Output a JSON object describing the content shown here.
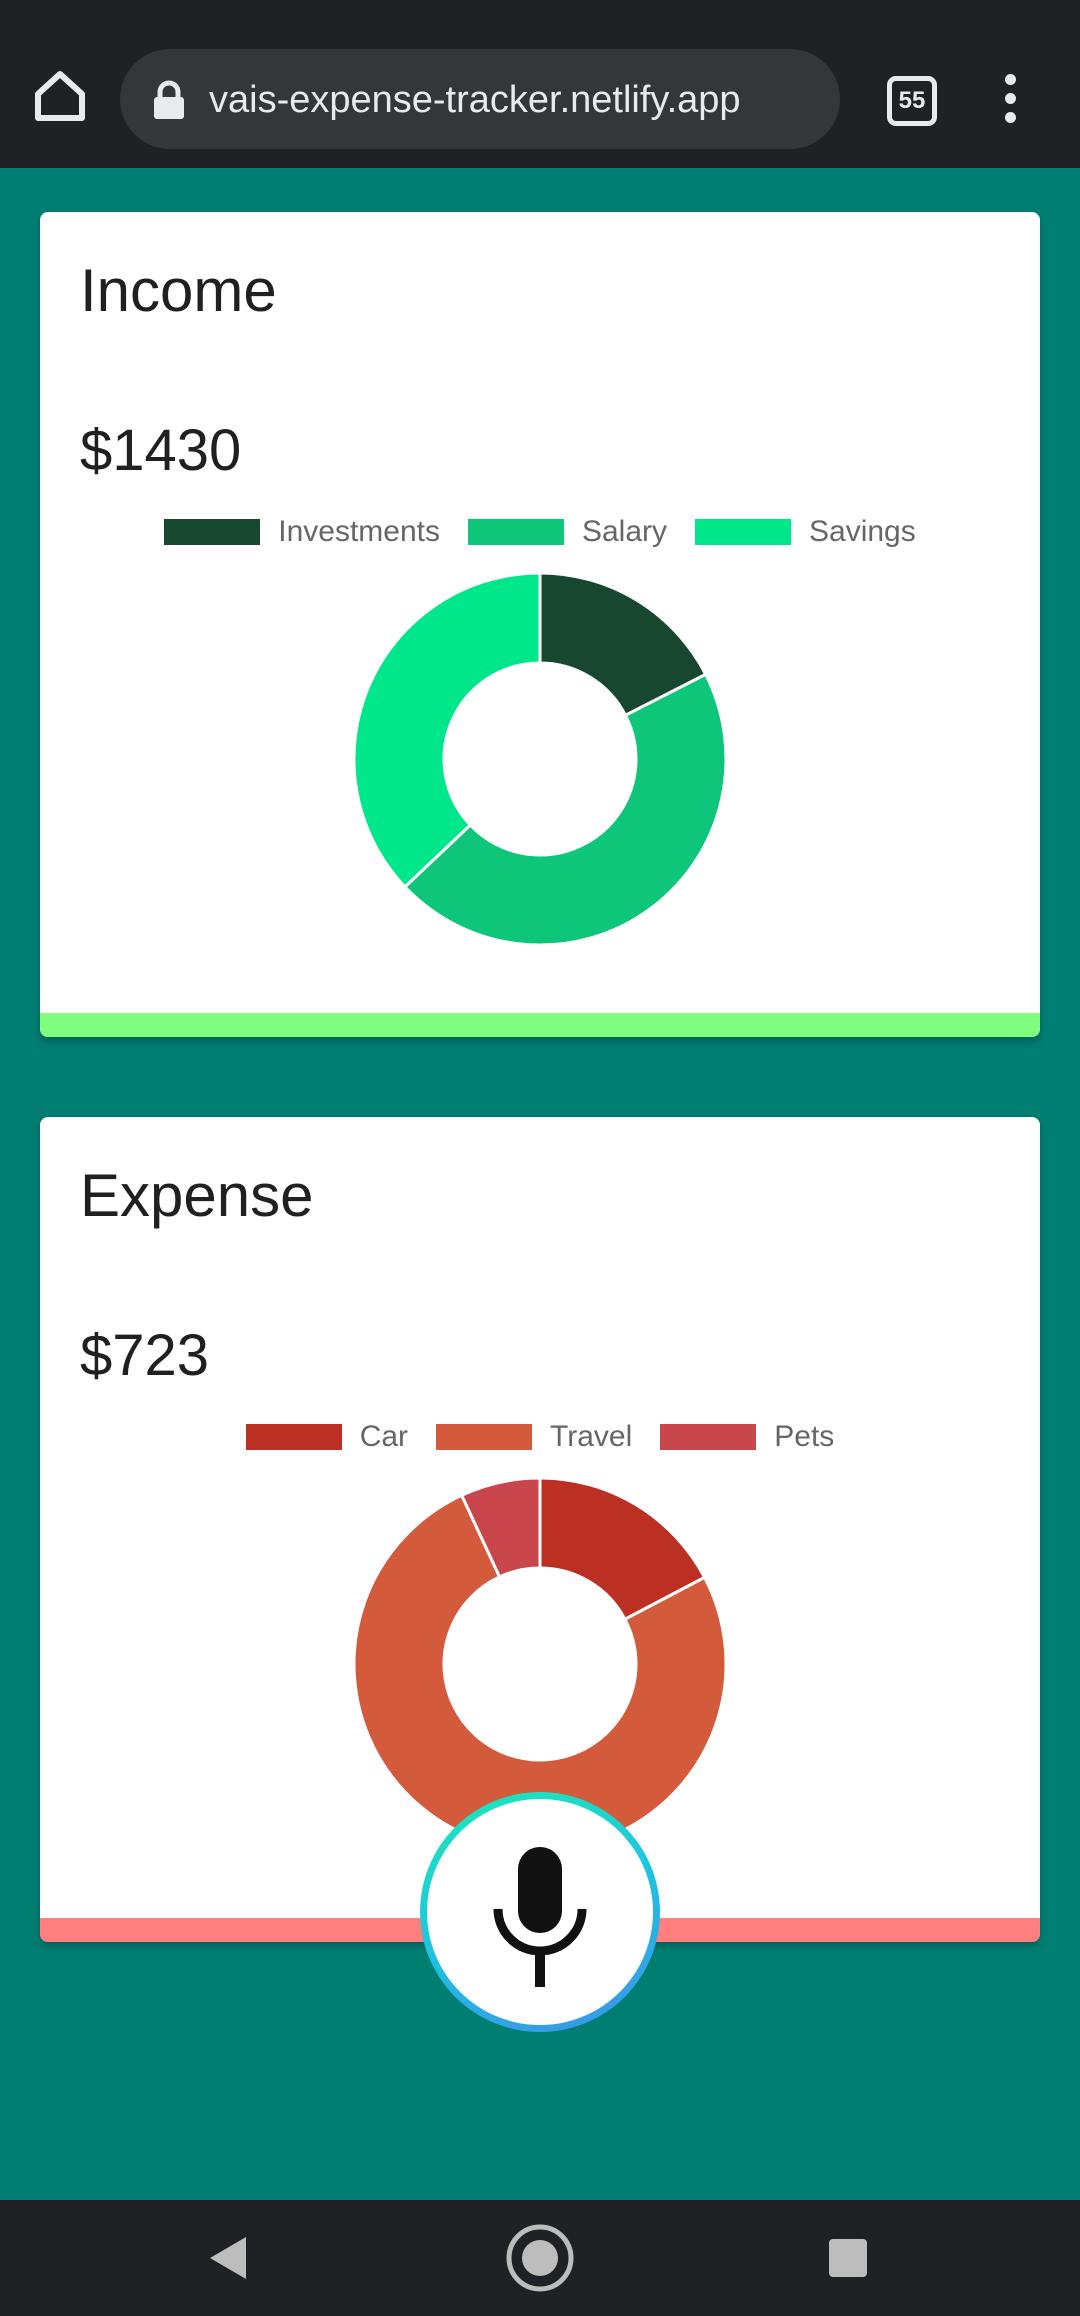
{
  "browser": {
    "url": "vais-expense-tracker.netlify.app",
    "tab_count": "55",
    "icons": {
      "home": "home-icon",
      "lock": "lock-icon",
      "menu": "more-vert-icon"
    }
  },
  "income": {
    "title": "Income",
    "amount": "$1430",
    "accent_color": "#80ff7f",
    "chart_data": {
      "type": "pie",
      "variant": "doughnut",
      "categories": [
        "Investments",
        "Salary",
        "Savings"
      ],
      "values": [
        250,
        650,
        530
      ],
      "colors": [
        "#17472f",
        "#0dc67a",
        "#00e68b"
      ],
      "legend": "top"
    }
  },
  "expense": {
    "title": "Expense",
    "amount": "$723",
    "accent_color": "#ff7f7f",
    "chart_data": {
      "type": "pie",
      "variant": "doughnut",
      "categories": [
        "Car",
        "Travel",
        "Pets"
      ],
      "values": [
        125,
        548,
        50
      ],
      "colors": [
        "#bc2f23",
        "#d35a3a",
        "#c9464c"
      ],
      "legend": "top"
    }
  },
  "voice": {
    "icon": "microphone-icon"
  },
  "system_nav": {
    "back": "back-icon",
    "home": "home-circle-icon",
    "recents": "recents-icon"
  }
}
